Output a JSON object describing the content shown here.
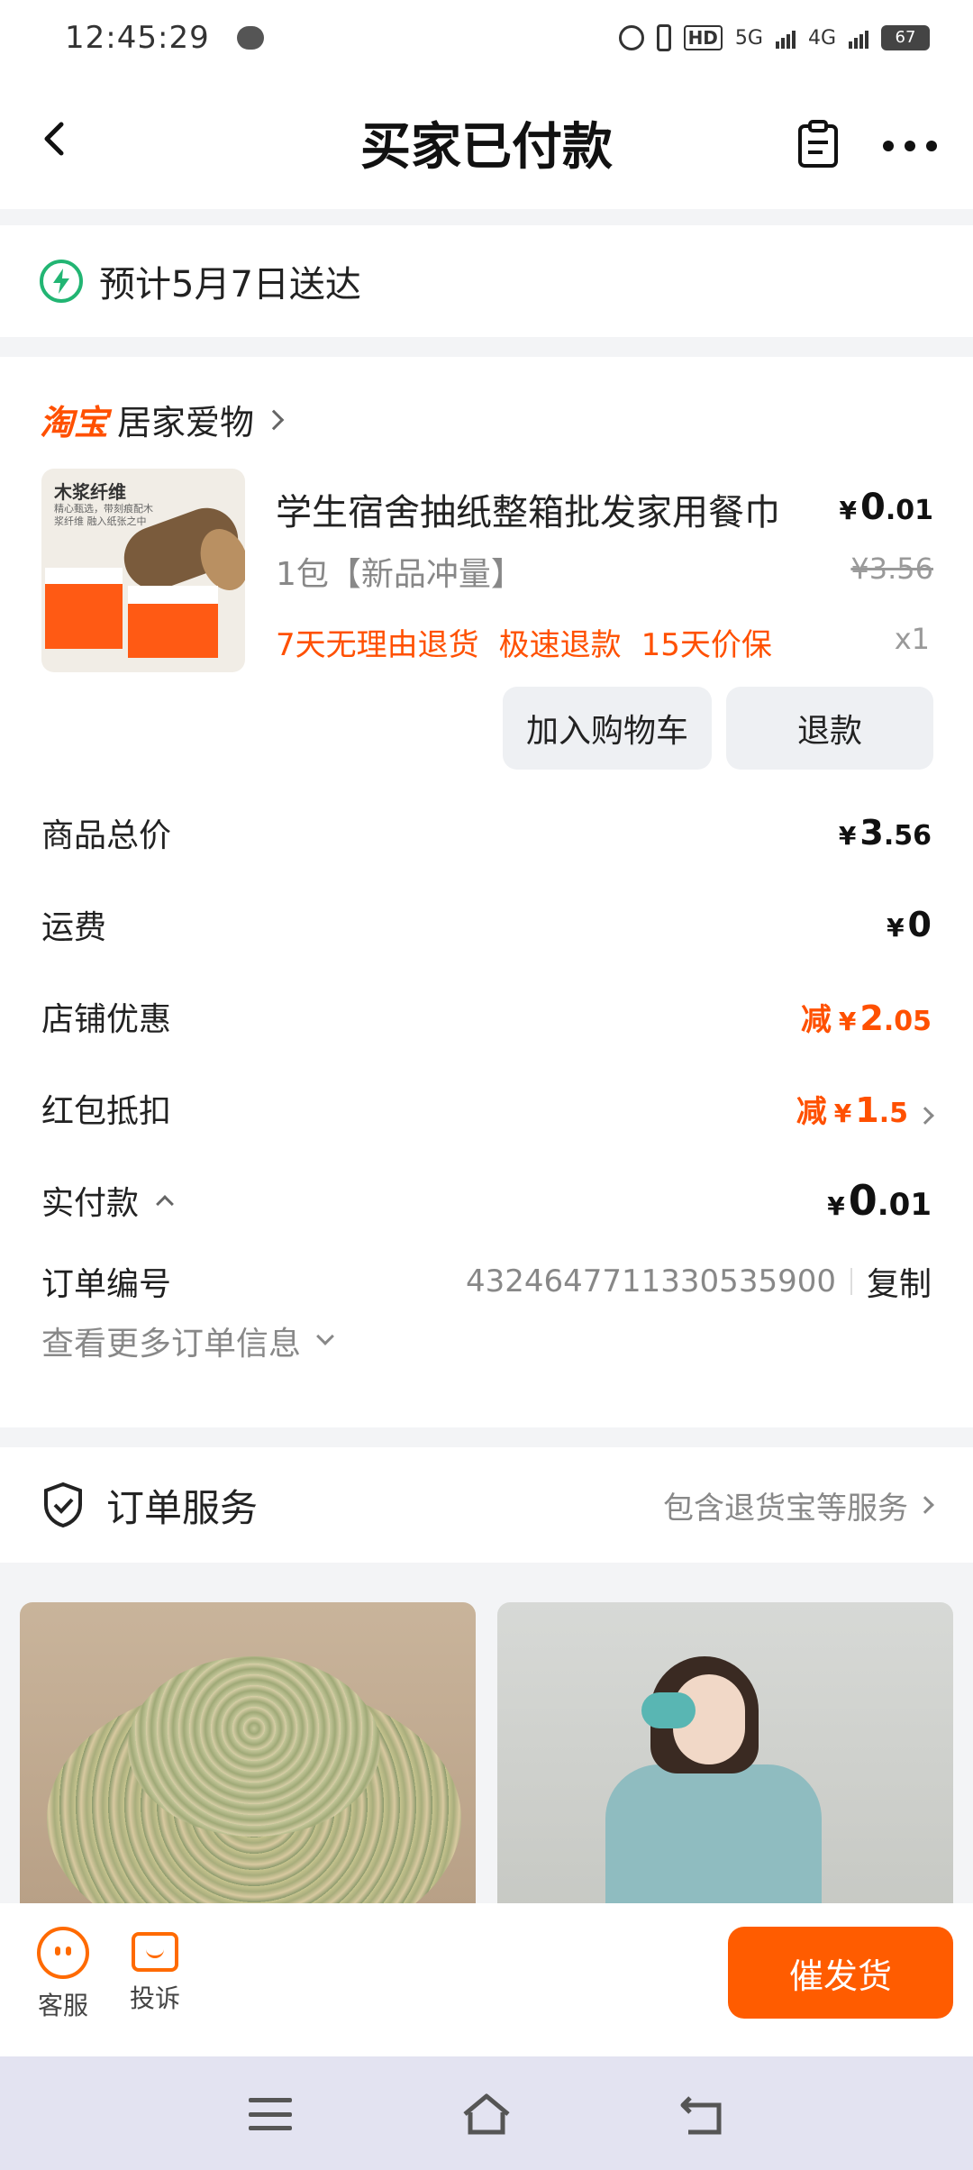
{
  "status_bar": {
    "time": "12:45:29",
    "network_1": "5G",
    "network_2": "4G",
    "hd_label": "HD",
    "battery": "67"
  },
  "header": {
    "title": "买家已付款"
  },
  "delivery": {
    "text": "预计5月7日送达"
  },
  "shop": {
    "platform_logo": "淘宝",
    "name": "居家爱物"
  },
  "product": {
    "image_caption": "木浆纤维",
    "image_subcaption": "精心甄选，带刻痕配木浆纤维 融入纸张之中",
    "title": "学生宿舍抽纸整箱批发家用餐巾",
    "spec": "1包【新品冲量】",
    "tags": [
      "7天无理由退货",
      "极速退款",
      "15天价保"
    ],
    "price_currency": "¥",
    "price_int": "0",
    "price_dec": ".01",
    "original_price": "¥3.56",
    "quantity": "x1",
    "add_cart_label": "加入购物车",
    "refund_label": "退款"
  },
  "summary": {
    "rows": [
      {
        "label": "商品总价",
        "prefix": "",
        "currency": "¥",
        "int": "3",
        "dec": ".56"
      },
      {
        "label": "运费",
        "prefix": "",
        "currency": "¥",
        "int": "0",
        "dec": ""
      },
      {
        "label": "店铺优惠",
        "prefix": "减",
        "currency": "¥",
        "int": "2",
        "dec": ".05"
      },
      {
        "label": "红包抵扣",
        "prefix": "减",
        "currency": "¥",
        "int": "1",
        "dec": ".5"
      },
      {
        "label": "实付款",
        "prefix": "",
        "currency": "¥",
        "int": "0",
        "dec": ".01"
      }
    ],
    "order_no_label": "订单编号",
    "order_no": "4324647711330535900",
    "copy_label": "复制",
    "more_info_label": "查看更多订单信息"
  },
  "service": {
    "label": "订单服务",
    "desc": "包含退货宝等服务"
  },
  "bottom_bar": {
    "customer_service": "客服",
    "complaint": "投诉",
    "urge_label": "催发货"
  },
  "colors": {
    "accent": "#ff5000",
    "urge_button": "#ff5c00",
    "delivery_icon": "#22b573"
  }
}
